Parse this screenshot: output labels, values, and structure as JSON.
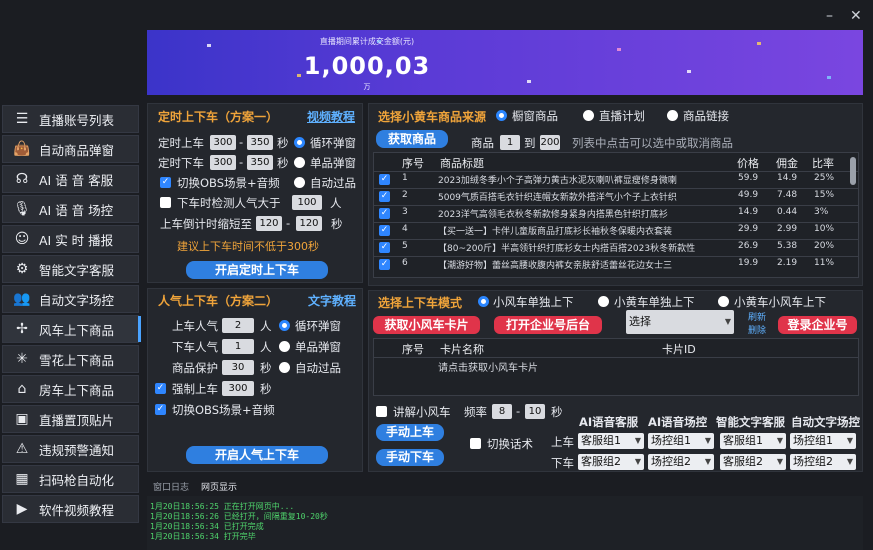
{
  "window": {
    "minimize": "–",
    "close": "✕"
  },
  "banner": {
    "caption": "直播期间累计成交金额(元)",
    "amount": "1,000,03",
    "unit": "万"
  },
  "sidebar": {
    "items": [
      {
        "label": "直播账号列表",
        "icon": "list-icon"
      },
      {
        "label": "自动商品弹窗",
        "icon": "bag-icon"
      },
      {
        "label": "AI 语 音 客服",
        "icon": "headset-icon"
      },
      {
        "label": "AI 语 音 场控",
        "icon": "mic-icon"
      },
      {
        "label": "AI 实 时 播报",
        "icon": "announcer-icon"
      },
      {
        "label": "智能文字客服",
        "icon": "robot-icon"
      },
      {
        "label": "自动文字场控",
        "icon": "users-icon"
      },
      {
        "label": "风车上下商品",
        "icon": "windmill-icon"
      },
      {
        "label": "雪花上下商品",
        "icon": "snowflake-icon"
      },
      {
        "label": "房车上下商品",
        "icon": "rv-icon"
      },
      {
        "label": "直播置顶贴片",
        "icon": "pin-icon"
      },
      {
        "label": "违规预警通知",
        "icon": "warning-icon"
      },
      {
        "label": "扫码枪自动化",
        "icon": "scanner-icon"
      },
      {
        "label": "软件视频教程",
        "icon": "video-icon"
      }
    ]
  },
  "timer": {
    "title": "定时上下车（方案一）",
    "tutorial": "视频教程",
    "on_label": "定时上车",
    "on_min": "300",
    "on_max": "350",
    "on_unit": "秒",
    "on_option": "循环弹窗",
    "off_label": "定时下车",
    "off_min": "300",
    "off_max": "350",
    "off_unit": "秒",
    "off_option": "单品弹窗",
    "switch_obs": "切换OBS场景+音频",
    "auto_pass": "自动过品",
    "detect_label": "下车时检测人气大于",
    "detect_value": "100",
    "detect_unit": "人",
    "countdown_label": "上车倒计时缩短至",
    "countdown_min": "120",
    "countdown_max": "120",
    "countdown_unit": "秒",
    "warning": "建议上下车时间不低于300秒",
    "start": "开启定时上下车"
  },
  "popularity": {
    "title": "人气上下车（方案二）",
    "tutorial": "文字教程",
    "on_label": "上车人气",
    "on_value": "2",
    "on_unit": "人",
    "opt1": "循环弹窗",
    "off_label": "下车人气",
    "off_value": "1",
    "off_unit": "人",
    "opt2": "单品弹窗",
    "protect_label": "商品保护",
    "protect_value": "30",
    "protect_unit": "秒",
    "opt3": "自动过品",
    "force_label": "强制上车",
    "force_value": "300",
    "force_unit": "秒",
    "switch_obs": "切换OBS场景+音频",
    "start": "开启人气上下车"
  },
  "source": {
    "title": "选择小黄车商品来源",
    "opt1": "橱窗商品",
    "opt2": "直播计划",
    "opt3": "商品链接",
    "fetch": "获取商品",
    "range_label": "商品",
    "range_from": "1",
    "range_to_label": "到",
    "range_to": "200",
    "hint": "列表中点击可以选中或取消商品",
    "columns": [
      "序号",
      "商品标题",
      "价格",
      "佣金",
      "比率"
    ],
    "rows": [
      {
        "no": "1",
        "title": "2023加绒冬季小个子高弹力黄古水泥灰喇叭裤显瘦修身微喇",
        "price": "59.9",
        "comm": "14.9",
        "rate": "25%"
      },
      {
        "no": "2",
        "title": "5009气质百搭毛衣针织连帽女新款外搭洋气小个子上衣针织",
        "price": "49.9",
        "comm": "7.48",
        "rate": "15%"
      },
      {
        "no": "3",
        "title": "2023洋气高领毛衣秋冬新款修身紧身内搭黑色针织打底衫",
        "price": "14.9",
        "comm": "0.44",
        "rate": "3%"
      },
      {
        "no": "4",
        "title": "【买一送一】卡伴儿童版商品打底衫长袖秋冬保暖内衣套装",
        "price": "29.9",
        "comm": "2.99",
        "rate": "10%"
      },
      {
        "no": "5",
        "title": "【80~200斤】半高领针织打底衫女士内搭百搭2023秋冬新款性",
        "price": "26.9",
        "comm": "5.38",
        "rate": "20%"
      },
      {
        "no": "6",
        "title": "【潮游好物】蕾丝高腰收腹内裤女亲肤舒适蕾丝花边女士三",
        "price": "19.9",
        "comm": "2.19",
        "rate": "11%"
      }
    ]
  },
  "mode": {
    "title": "选择上下车模式",
    "opt1": "小风车单独上下",
    "opt2": "小黄车单独上下",
    "opt3": "小黄车小风车上下",
    "get_card": "获取小风车卡片",
    "open_backend": "打开企业号后台",
    "select_value": "选择",
    "refresh": "刷新",
    "delete": "删除",
    "login": "登录企业号",
    "columns": [
      "序号",
      "卡片名称",
      "卡片ID"
    ],
    "placeholder_row": "请点击获取小风车卡片",
    "explain_label": "讲解小风车",
    "freq_label": "频率",
    "freq_min": "8",
    "freq_max": "10",
    "freq_unit": "秒",
    "manual_on": "手动上车",
    "manual_off": "手动下车",
    "switch_script": "切换话术",
    "headers": [
      "AI语音客服",
      "AI语音场控",
      "智能文字客服",
      "自动文字场控"
    ],
    "on_row_label": "上车",
    "off_row_label": "下车",
    "on_values": [
      "客服组1",
      "场控组1",
      "客服组1",
      "场控组1"
    ],
    "off_values": [
      "客服组2",
      "场控组2",
      "客服组2",
      "场控组2"
    ]
  },
  "log": {
    "tabs": [
      "窗口日志",
      "网页显示"
    ],
    "lines": [
      "1月20日18:56:25 正在打开网页中...",
      "1月20日18:56:26 已经打开，间隔重复10-20秒",
      "1月20日18:56:34 已打开完成",
      "1月20日18:56:34 打开完毕"
    ]
  }
}
